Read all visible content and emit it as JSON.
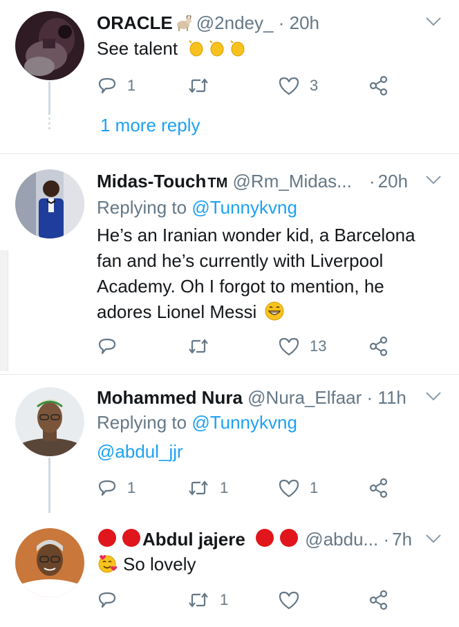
{
  "colors": {
    "accent": "#1da1f2",
    "muted": "#657786",
    "text": "#14171a",
    "separator": "#e1e8ed",
    "badge_red": "#e0161c"
  },
  "tweets": [
    {
      "name": "ORACLE",
      "name_emoji": "goat",
      "handle": "@2ndey_",
      "dot": "·",
      "time": "20h",
      "body": "See talent",
      "body_emoji": [
        "clapping-hands",
        "clapping-hands",
        "clapping-hands"
      ],
      "replies": "1",
      "retweets": "",
      "likes": "3",
      "more_reply": "1 more reply"
    },
    {
      "name": "Midas-Touch",
      "name_suffix": "TM",
      "handle": "@Rm_Midas...",
      "dot": "·",
      "time": "20h",
      "replying_prefix": "Replying to",
      "replying_to": "@Tunnykvng",
      "body_lines": [
        "He’s an Iranian wonder kid, a Barcelona",
        "fan and he’s currently with Liverpool",
        "Academy. Oh I forgot to mention, he",
        "adores Lionel Messi"
      ],
      "body_emoji": "grinning-face",
      "replies": "",
      "retweets": "",
      "likes": "13"
    },
    {
      "name": "Mohammed Nura",
      "handle": "@Nura_Elfaar",
      "dot": "·",
      "time": "11h",
      "replying_prefix": "Replying to",
      "replying_to": "@Tunnykvng",
      "body": "@abdul_jjr",
      "replies": "1",
      "retweets": "1",
      "likes": "1"
    },
    {
      "name": "Abdul jajere",
      "name_emoji": "red-circles",
      "handle": "@abdu...",
      "dot": "·",
      "time": "7h",
      "body": "So lovely",
      "body_emoji": "smiling-face-with-hearts",
      "replies": "",
      "retweets": "1",
      "likes": ""
    }
  ]
}
